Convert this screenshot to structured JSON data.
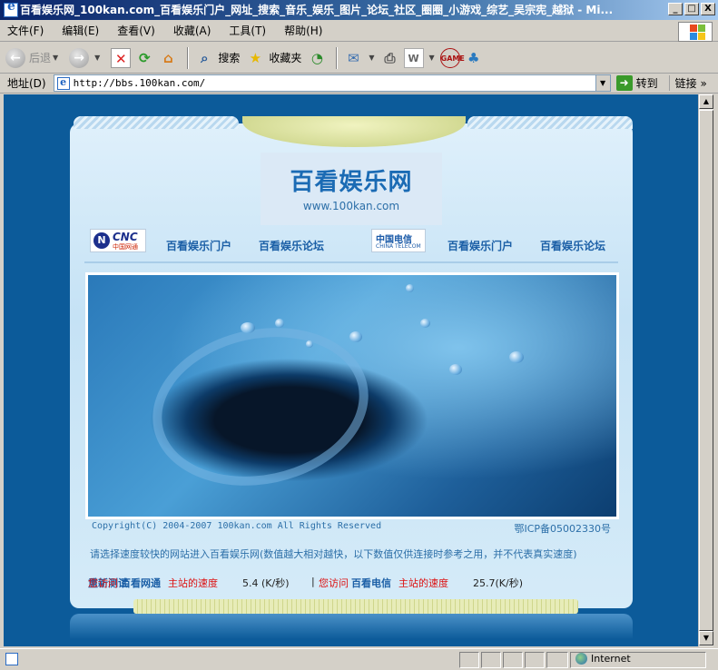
{
  "window": {
    "title": "百看娱乐网_100kan.com_百看娱乐门户_网址_搜索_音乐_娱乐_图片_论坛_社区_圈圈_小游戏_综艺_吴宗宪_越狱 - Mi...",
    "controls": {
      "minimize": "_",
      "maximize": "□",
      "close": "X"
    }
  },
  "menu": [
    "文件(F)",
    "编辑(E)",
    "查看(V)",
    "收藏(A)",
    "工具(T)",
    "帮助(H)"
  ],
  "toolbar": {
    "back": "后退",
    "search": "搜索",
    "favorites": "收藏夹"
  },
  "address": {
    "label": "地址(D)",
    "url": "http://bbs.100kan.com/",
    "go": "转到",
    "links": "链接"
  },
  "page": {
    "site_name": "百看娱乐网",
    "site_url": "www.100kan.com",
    "cnc": {
      "logo_text": "CNC",
      "logo_sub": "中国网通",
      "portal": "百看娱乐门户",
      "forum": "百看娱乐论坛"
    },
    "telecom": {
      "logo_text": "中国电信",
      "logo_sub": "CHINA TELECOM",
      "portal": "百看娱乐门户",
      "forum": "百看娱乐论坛"
    },
    "copyright": "Copyright(C) 2004-2007 100kan.com All Rights Reserved",
    "icp": "鄂ICP备05002330号",
    "notice": "请选择速度较快的网站进入百看娱乐网(数值越大相对越快，以下数值仅供连接时参考之用，并不代表真实速度)",
    "speed": {
      "cnc_prefix": "您访问",
      "cnc_name": "百看网通",
      "cnc_suffix": "主站的速度",
      "cnc_value": "5.4 (K/秒)",
      "separator": "|",
      "tel_prefix": "您访问",
      "tel_name": "百看电信",
      "tel_suffix": "主站的速度",
      "tel_value": "25.7(K/秒)",
      "retest": "重新测试"
    }
  },
  "status": {
    "zone": "Internet"
  }
}
